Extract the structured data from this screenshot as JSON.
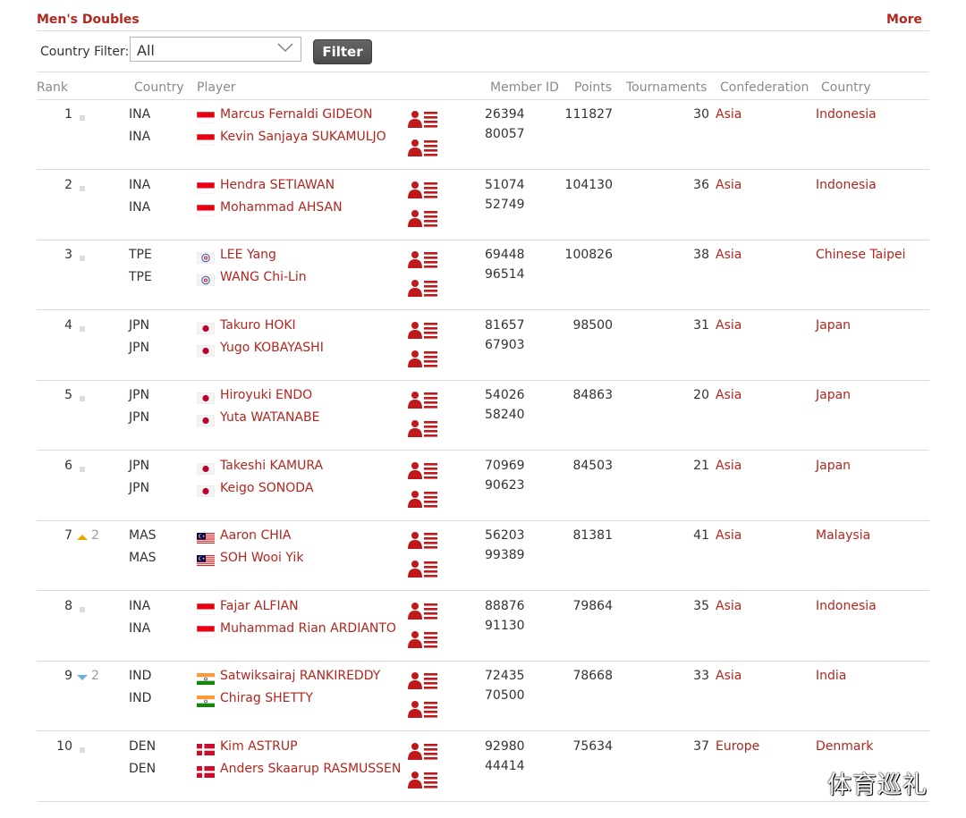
{
  "section": {
    "title": "Men's Doubles",
    "more_label": "More"
  },
  "filter": {
    "label": "Country Filter:",
    "selected": "All",
    "button_label": "Filter"
  },
  "columns": {
    "rank": "Rank",
    "country": "Country",
    "player": "Player",
    "member_id": "Member ID",
    "points": "Points",
    "tournaments": "Tournaments",
    "confederation": "Confederation",
    "country2": "Country"
  },
  "rows": [
    {
      "rank": "1",
      "change": "",
      "trend": "same",
      "players": [
        {
          "code": "INA",
          "flag": "indonesia",
          "name": "Marcus Fernaldi GIDEON",
          "member_id": "26394"
        },
        {
          "code": "INA",
          "flag": "indonesia",
          "name": "Kevin Sanjaya SUKAMULJO",
          "member_id": "80057"
        }
      ],
      "points": "111827",
      "tournaments": "30",
      "confederation": "Asia",
      "country": "Indonesia"
    },
    {
      "rank": "2",
      "change": "",
      "trend": "same",
      "players": [
        {
          "code": "INA",
          "flag": "indonesia",
          "name": "Hendra SETIAWAN",
          "member_id": "51074"
        },
        {
          "code": "INA",
          "flag": "indonesia",
          "name": "Mohammad AHSAN",
          "member_id": "52749"
        }
      ],
      "points": "104130",
      "tournaments": "36",
      "confederation": "Asia",
      "country": "Indonesia"
    },
    {
      "rank": "3",
      "change": "",
      "trend": "same",
      "players": [
        {
          "code": "TPE",
          "flag": "chinese-taipei",
          "name": "LEE Yang",
          "member_id": "69448"
        },
        {
          "code": "TPE",
          "flag": "chinese-taipei",
          "name": "WANG Chi-Lin",
          "member_id": "96514"
        }
      ],
      "points": "100826",
      "tournaments": "38",
      "confederation": "Asia",
      "country": "Chinese Taipei"
    },
    {
      "rank": "4",
      "change": "",
      "trend": "same",
      "players": [
        {
          "code": "JPN",
          "flag": "japan",
          "name": "Takuro HOKI",
          "member_id": "81657"
        },
        {
          "code": "JPN",
          "flag": "japan",
          "name": "Yugo KOBAYASHI",
          "member_id": "67903"
        }
      ],
      "points": "98500",
      "tournaments": "31",
      "confederation": "Asia",
      "country": "Japan"
    },
    {
      "rank": "5",
      "change": "",
      "trend": "same",
      "players": [
        {
          "code": "JPN",
          "flag": "japan",
          "name": "Hiroyuki ENDO",
          "member_id": "54026"
        },
        {
          "code": "JPN",
          "flag": "japan",
          "name": "Yuta WATANABE",
          "member_id": "58240"
        }
      ],
      "points": "84863",
      "tournaments": "20",
      "confederation": "Asia",
      "country": "Japan"
    },
    {
      "rank": "6",
      "change": "",
      "trend": "same",
      "players": [
        {
          "code": "JPN",
          "flag": "japan",
          "name": "Takeshi KAMURA",
          "member_id": "70969"
        },
        {
          "code": "JPN",
          "flag": "japan",
          "name": "Keigo SONODA",
          "member_id": "90623"
        }
      ],
      "points": "84503",
      "tournaments": "21",
      "confederation": "Asia",
      "country": "Japan"
    },
    {
      "rank": "7",
      "change": "2",
      "trend": "up",
      "players": [
        {
          "code": "MAS",
          "flag": "malaysia",
          "name": "Aaron CHIA",
          "member_id": "56203"
        },
        {
          "code": "MAS",
          "flag": "malaysia",
          "name": "SOH Wooi Yik",
          "member_id": "99389"
        }
      ],
      "points": "81381",
      "tournaments": "41",
      "confederation": "Asia",
      "country": "Malaysia"
    },
    {
      "rank": "8",
      "change": "",
      "trend": "same",
      "players": [
        {
          "code": "INA",
          "flag": "indonesia",
          "name": "Fajar ALFIAN",
          "member_id": "88876"
        },
        {
          "code": "INA",
          "flag": "indonesia",
          "name": "Muhammad Rian ARDIANTO",
          "member_id": "91130"
        }
      ],
      "points": "79864",
      "tournaments": "35",
      "confederation": "Asia",
      "country": "Indonesia"
    },
    {
      "rank": "9",
      "change": "2",
      "trend": "down",
      "players": [
        {
          "code": "IND",
          "flag": "india",
          "name": "Satwiksairaj RANKIREDDY",
          "member_id": "72435"
        },
        {
          "code": "IND",
          "flag": "india",
          "name": "Chirag SHETTY",
          "member_id": "70500"
        }
      ],
      "points": "78668",
      "tournaments": "33",
      "confederation": "Asia",
      "country": "India"
    },
    {
      "rank": "10",
      "change": "",
      "trend": "same",
      "players": [
        {
          "code": "DEN",
          "flag": "denmark",
          "name": "Kim ASTRUP",
          "member_id": "92980"
        },
        {
          "code": "DEN",
          "flag": "denmark",
          "name": "Anders Skaarup RASMUSSEN",
          "member_id": "44414"
        }
      ],
      "points": "75634",
      "tournaments": "37",
      "confederation": "Europe",
      "country": "Denmark"
    }
  ],
  "icons": {
    "profile": "player-profile-icon",
    "dropdown": "chevron-down-icon"
  },
  "colors": {
    "accent": "#b3261e",
    "button": "#555555",
    "up": "#f0a800",
    "down": "#6ab0e0"
  },
  "watermark": "体育巡礼"
}
